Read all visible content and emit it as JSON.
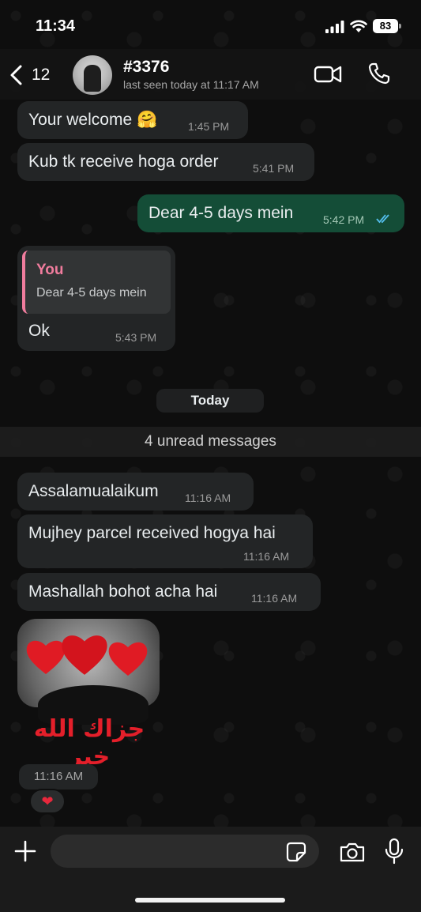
{
  "status_bar": {
    "time": "11:34",
    "battery": "83"
  },
  "header": {
    "back_count": "12",
    "contact_name": "#3376",
    "last_seen": "last seen today at 11:17 AM"
  },
  "messages": [
    {
      "direction": "in",
      "text": "Your welcome 🤗",
      "time": "1:45 PM"
    },
    {
      "direction": "in",
      "text": "Kub tk receive hoga order",
      "time": "5:41 PM"
    },
    {
      "direction": "out",
      "text": "Dear 4-5 days mein",
      "time": "5:42 PM",
      "read": true
    },
    {
      "direction": "in",
      "reply_to": {
        "author": "You",
        "text": "Dear 4-5 days mein"
      },
      "text": "Ok",
      "time": "5:43 PM"
    }
  ],
  "date_divider": "Today",
  "unread_banner": "4 unread messages",
  "today_messages": [
    {
      "direction": "in",
      "text": "Assalamualaikum",
      "time": "11:16 AM"
    },
    {
      "direction": "in",
      "text": "Mujhey parcel received hogya hai",
      "time": "11:16 AM"
    },
    {
      "direction": "in",
      "text": "Mashallah bohot acha hai",
      "time": "11:16 AM"
    }
  ],
  "sticker": {
    "text": "جزاك الله خير",
    "time": "11:16 AM",
    "reaction": "❤"
  },
  "colors": {
    "outgoing_bubble": "#144d37",
    "incoming_bubble": "#232526",
    "quote_accent": "#f07c9d",
    "read_ticks": "#53bdeb"
  },
  "icons": [
    "back-chevron-icon",
    "video-call-icon",
    "phone-icon",
    "plus-icon",
    "sticker-icon",
    "camera-icon",
    "mic-icon",
    "signal-icon",
    "wifi-icon"
  ]
}
